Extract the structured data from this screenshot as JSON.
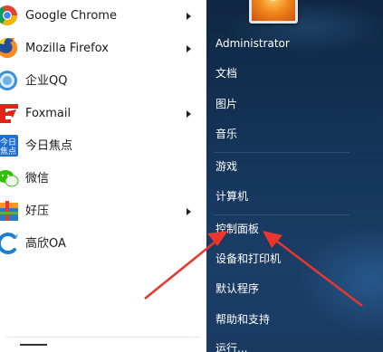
{
  "programs": [
    {
      "label": "Google Chrome",
      "icon": "chrome-icon",
      "has_submenu": true
    },
    {
      "label": "Mozilla Firefox",
      "icon": "firefox-icon",
      "has_submenu": true
    },
    {
      "label": "企业QQ",
      "icon": "enterprise-qq-icon",
      "has_submenu": false
    },
    {
      "label": "Foxmail",
      "icon": "foxmail-icon",
      "has_submenu": true
    },
    {
      "label": "今日焦点",
      "icon": "today-focus-icon",
      "has_submenu": false
    },
    {
      "label": "微信",
      "icon": "wechat-icon",
      "has_submenu": false
    },
    {
      "label": "好压",
      "icon": "haozip-icon",
      "has_submenu": true
    },
    {
      "label": "高欣OA",
      "icon": "gaoxin-oa-icon",
      "has_submenu": false
    }
  ],
  "icon_text": {
    "today_focus": "今日焦点"
  },
  "right_items": [
    {
      "label": "Administrator"
    },
    {
      "label": "文档"
    },
    {
      "label": "图片"
    },
    {
      "label": "音乐"
    },
    {
      "label": "游戏"
    },
    {
      "label": "计算机"
    },
    {
      "label": "控制面板"
    },
    {
      "label": "设备和打印机"
    },
    {
      "label": "默认程序"
    },
    {
      "label": "帮助和支持"
    },
    {
      "label": "运行..."
    }
  ],
  "colors": {
    "annotation": "#e8372c",
    "right_pane_top": "#0f2742",
    "right_pane_bottom": "#1a3a62",
    "menu_text_dark": "#1a1a1a",
    "menu_text_light": "#ffffff"
  }
}
